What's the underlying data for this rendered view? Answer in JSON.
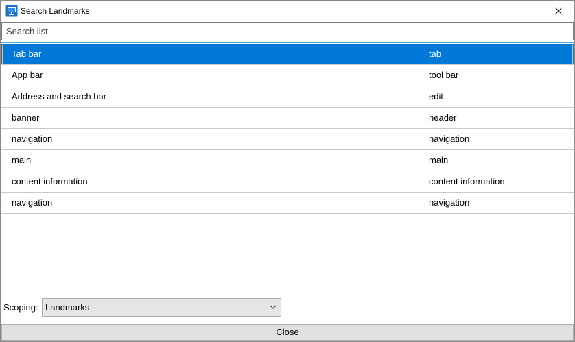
{
  "window": {
    "title": "Search Landmarks"
  },
  "icons": {
    "app": "monitor-app-icon",
    "close": "close-icon",
    "dropdown": "chevron-down-icon"
  },
  "search": {
    "placeholder": "Search list",
    "value": ""
  },
  "list": {
    "items": [
      {
        "name": "Tab bar",
        "type": "tab",
        "selected": true
      },
      {
        "name": "App bar",
        "type": "tool bar",
        "selected": false
      },
      {
        "name": "Address and search bar",
        "type": "edit",
        "selected": false
      },
      {
        "name": "banner",
        "type": "header",
        "selected": false
      },
      {
        "name": "navigation",
        "type": "navigation",
        "selected": false
      },
      {
        "name": "main",
        "type": "main",
        "selected": false
      },
      {
        "name": "content information",
        "type": "content information",
        "selected": false
      },
      {
        "name": "navigation",
        "type": "navigation",
        "selected": false
      }
    ]
  },
  "scoping": {
    "label": "Scoping:",
    "selected": "Landmarks"
  },
  "footer": {
    "close_label": "Close"
  },
  "colors": {
    "selection": "#0078d7",
    "accent_line": "#4ea7dd",
    "button_face": "#e1e1e1",
    "row_divider": "#c9c9c9"
  }
}
